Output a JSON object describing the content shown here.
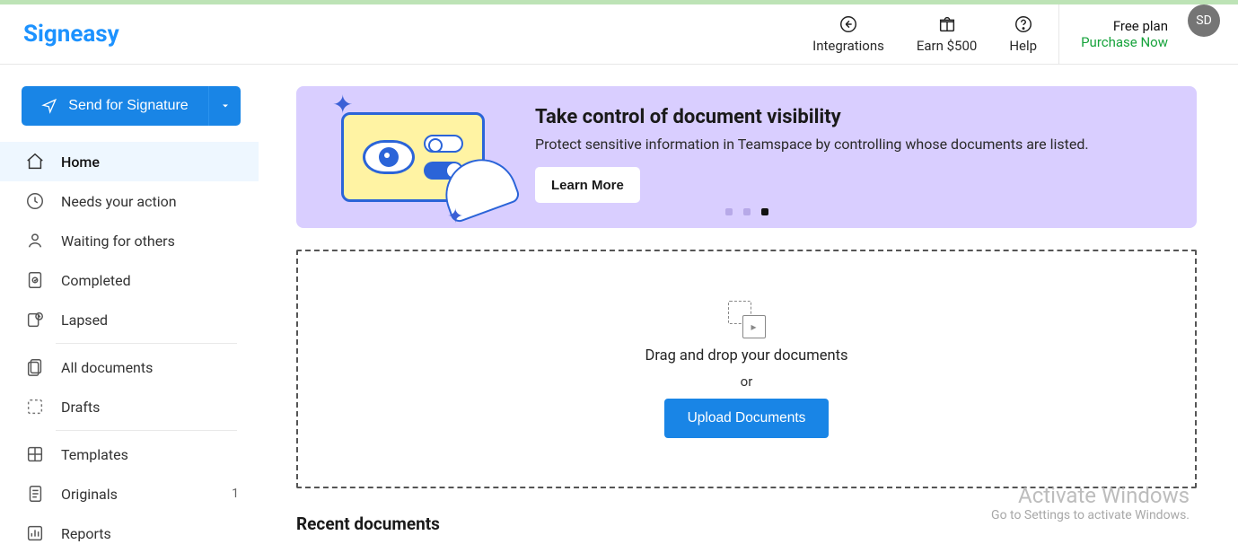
{
  "brand": "Signeasy",
  "header": {
    "integrations": "Integrations",
    "earn": "Earn $500",
    "help": "Help",
    "plan_label": "Free plan",
    "purchase": "Purchase Now",
    "avatar_initials": "SD"
  },
  "sidebar": {
    "send_label": "Send for Signature",
    "items": [
      {
        "label": "Home",
        "icon": "home-icon",
        "active": true
      },
      {
        "label": "Needs your action",
        "icon": "clock-icon"
      },
      {
        "label": "Waiting for others",
        "icon": "person-wait-icon"
      },
      {
        "label": "Completed",
        "icon": "completed-icon"
      },
      {
        "label": "Lapsed",
        "icon": "lapsed-icon"
      }
    ],
    "items2": [
      {
        "label": "All documents",
        "icon": "documents-icon"
      },
      {
        "label": "Drafts",
        "icon": "drafts-icon"
      }
    ],
    "items3": [
      {
        "label": "Templates",
        "icon": "templates-icon"
      },
      {
        "label": "Originals",
        "icon": "originals-icon",
        "count": "1"
      },
      {
        "label": "Reports",
        "icon": "reports-icon"
      }
    ]
  },
  "banner": {
    "title": "Take control of document visibility",
    "subtitle": "Protect sensitive information in Teamspace by controlling whose documents are listed.",
    "cta": "Learn More",
    "active_dot": 2,
    "dot_count": 3
  },
  "dropzone": {
    "text": "Drag and drop your documents",
    "or": "or",
    "button": "Upload Documents"
  },
  "recent": {
    "heading": "Recent documents"
  },
  "watermark": {
    "line1": "Activate Windows",
    "line2": "Go to Settings to activate Windows."
  }
}
